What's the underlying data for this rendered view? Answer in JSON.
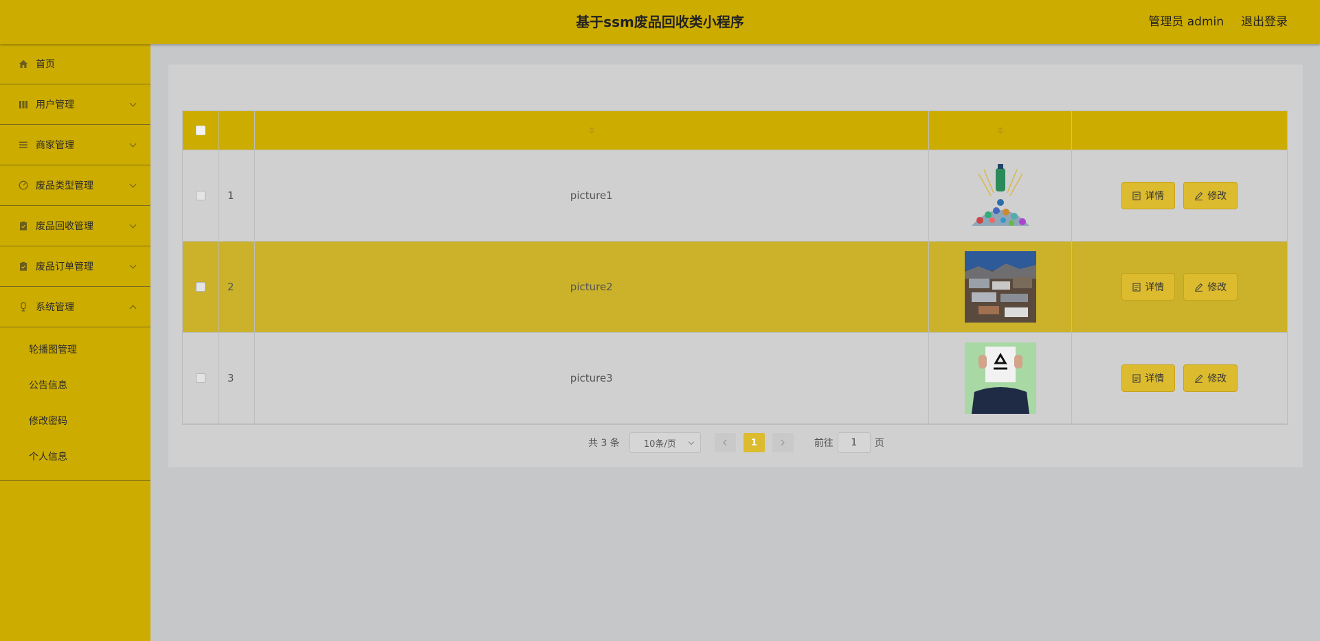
{
  "header": {
    "title": "基于ssm废品回收类小程序",
    "user": "管理员 admin",
    "logout": "退出登录"
  },
  "sidebar": {
    "items": [
      {
        "label": "首页",
        "icon": "home-icon"
      },
      {
        "label": "用户管理",
        "icon": "users-icon"
      },
      {
        "label": "商家管理",
        "icon": "list-icon"
      },
      {
        "label": "废品类型管理",
        "icon": "dashboard-icon"
      },
      {
        "label": "废品回收管理",
        "icon": "clipboard-icon"
      },
      {
        "label": "废品订单管理",
        "icon": "clipboard-icon"
      },
      {
        "label": "系统管理",
        "icon": "system-icon"
      }
    ],
    "system_sub": [
      "轮播图管理",
      "公告信息",
      "修改密码",
      "个人信息"
    ]
  },
  "table": {
    "rows": [
      {
        "index": "1",
        "name": "picture1"
      },
      {
        "index": "2",
        "name": "picture2"
      },
      {
        "index": "3",
        "name": "picture3"
      }
    ],
    "detail_label": "详情",
    "edit_label": "修改"
  },
  "pager": {
    "total": "共 3 条",
    "page_size": "10条/页",
    "current": "1",
    "goto_label": "前往",
    "goto_value": "1",
    "page_unit": "页"
  },
  "colors": {
    "primary": "#cdac00",
    "button": "#dcbb2e",
    "background": "#c6c7c9"
  }
}
